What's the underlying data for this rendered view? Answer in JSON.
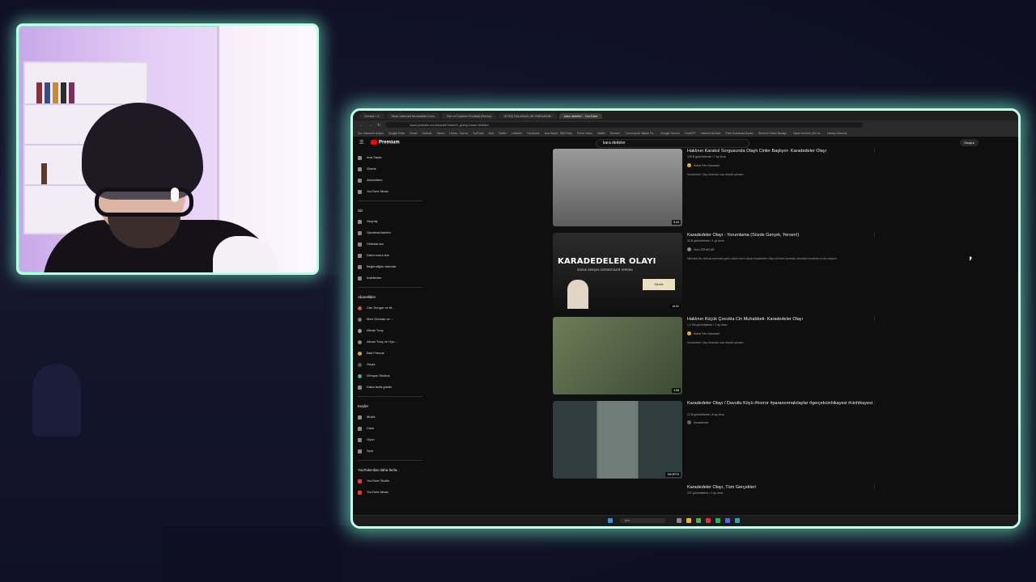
{
  "browser": {
    "tabs": [
      "Gnnew / X",
      "Most Interneti Motosiklet Croh",
      "Out of Context Football (Remo)",
      "SİTEŞ FALASAN OK PARANORı",
      "kara dedeler - YouTube"
    ],
    "url": "www.youtube.com/results?search_query=kara+dedeler",
    "bookmarks": [
      "Sıcı Internet'e erişim",
      "Google Drive",
      "Gmail",
      "Outlook",
      "Yahoo",
      "Home - Canva",
      "YouTube",
      "Bolt",
      "Twitter",
      "LinkedIn",
      "Facebook",
      "Ana Sayfa - HBO Max",
      "Prime Video",
      "Netflix",
      "Disney+",
      "Crunchyroll: Watch Po...",
      "Google Gemini",
      "ChatGPT",
      "Internet Archive",
      "Free Download Books",
      "Remove Video Backgr...",
      "Akoril Archive (All Ca...",
      "Library Genesis"
    ]
  },
  "youtube": {
    "logo": "Premium",
    "search_query": "kara dedeler",
    "create_label": "Oluştur"
  },
  "sidebar": {
    "main": [
      "Ana Sayfa",
      "Shorts",
      "Abonelikler",
      "YouTube Music"
    ],
    "you_heading": "Siz",
    "you_items": [
      "Geçmiş",
      "Oynatma listeleri",
      "Videolarınız",
      "Daha sonra izle",
      "Beğendiğim videolar",
      "İndirilenler"
    ],
    "subs_heading": "Abonelikler",
    "subs_items": [
      "Can Sungur ve M...",
      "Mert Günhan ve ...",
      "Alican Tunç",
      "Alican Tunç ve Oyu...",
      "Bad Friends",
      "Geçia",
      "Gringus Studios",
      "Daha fazla göster"
    ],
    "explore_heading": "Keşfet",
    "explore_items": [
      "Müzik",
      "Canlı",
      "Oyun",
      "Spor"
    ],
    "more_heading": "YouTube'dan daha fazla...",
    "more_items": [
      "YouTube Studio",
      "YouTube Music"
    ]
  },
  "results": [
    {
      "title": "Haklının Karakol Sorgusunda Olaylı Cinler Başlıyor- Karadedeler Olayı",
      "meta": "135 B görüntüleme • 7 ay önce",
      "channel": "Ebedi Film Sahneleri",
      "desc": "Karadedeler Olayı filminden kısa birşekil sahneler",
      "duration": "5:44"
    },
    {
      "title": "Karadedeler Olayı - Yorumlama (Sözde Gerçek, Yersen!)",
      "meta": "32 B görüntüleme • 1 yıl önce",
      "channel": "Doru ÖZHACAR",
      "desc": "Merhaba, Bu videoda sinemada gelen sözüm imeli olarak Karadedeler Olayı adlı filmi inceledik, dinealarla inceledik ve ses ortaçıktı",
      "duration": "16:52",
      "thumb_title": "KARADEDELER OLAYI",
      "thumb_sub": "SÖZDE GERÇEK GÖRÜNTÜLER YERSEN",
      "sign": "Sözde"
    },
    {
      "title": "Haklının Küçük Çocukla Cin Muhabbeti- Karadedeler Olayı",
      "meta": "1,1 Mn görüntüleme • 7 ay önce",
      "channel": "Ebedi Film Sahneleri",
      "desc": "Karadedeler Olayı filminden kısa birşekil sahneler",
      "duration": "3:58"
    },
    {
      "title": "Karadedeler Olayı / Davutlu Köyü #horror #paranormalolaylar #gerçekcinhikayesi #cinhikayesi",
      "meta": "12 B görüntüleme • 8 ay önce",
      "channel": "Korantheart",
      "desc": "",
      "duration": "SHORTS"
    },
    {
      "title": "Karadedeler Olayı, Tüm Gerçekleri",
      "meta": "237 görüntüleme • 1 ay önce",
      "channel": "",
      "desc": "",
      "duration": ""
    }
  ],
  "taskbar": {
    "search_placeholder": "Ara"
  },
  "colors": {
    "frame_glow": "#c7ffe9",
    "youtube_red": "#ff0000",
    "yt_bg": "#0f0f0f"
  }
}
